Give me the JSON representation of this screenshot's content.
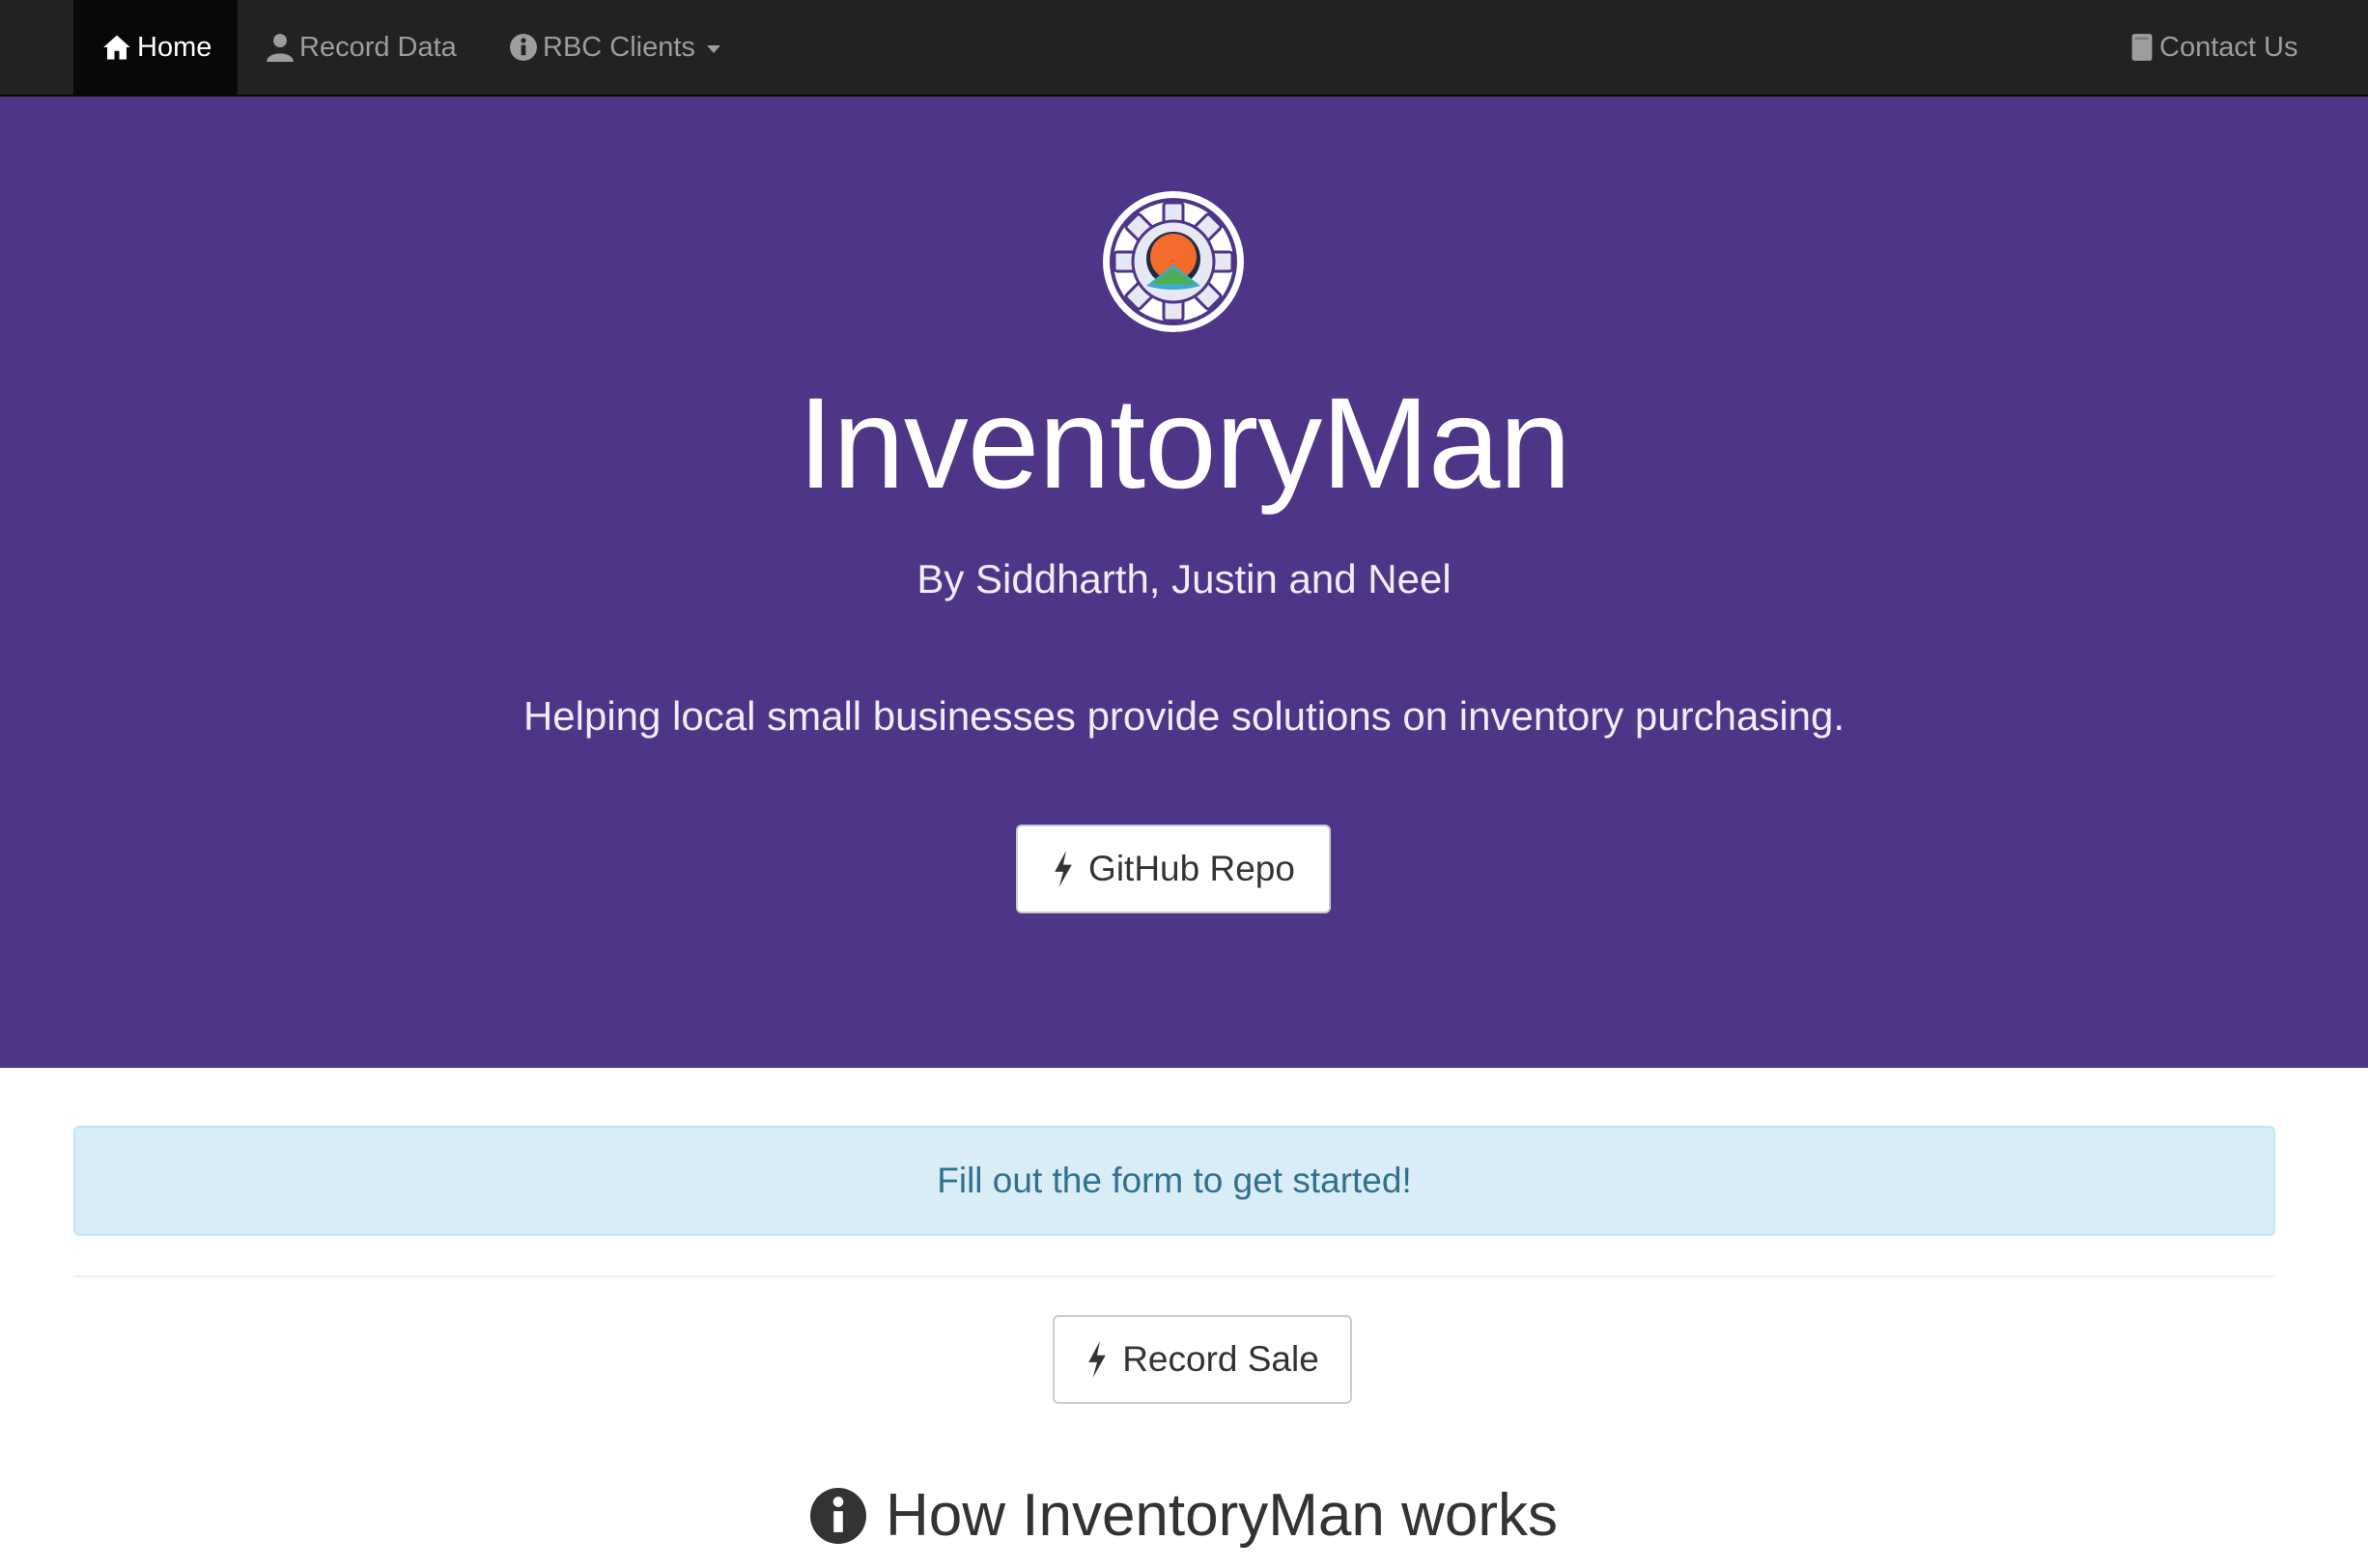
{
  "nav": {
    "home_label": "Home",
    "home_icon": "home-icon",
    "record_label": "Record Data",
    "record_icon": "user-icon",
    "clients_label": "RBC Clients",
    "clients_icon": "info-icon",
    "contact_label": "Contact Us",
    "contact_icon": "book-icon"
  },
  "hero": {
    "logo_icon": "gear-logo-icon",
    "title": "InventoryMan",
    "subtitle": "By Siddharth, Justin and Neel",
    "tagline": "Helping local small businesses provide solutions on inventory purchasing.",
    "github_button": "GitHub Repo",
    "github_icon": "flash-icon",
    "background_color": "#4e3587"
  },
  "main": {
    "alert_text": "Fill out the form to get started!",
    "record_sale_button": "Record Sale",
    "record_sale_icon": "flash-icon",
    "section_heading": "How InventoryMan works",
    "section_icon": "info-circle-icon"
  },
  "colors": {
    "navbar": "#222222",
    "hero": "#4e3587",
    "alert_bg": "#d9edf7",
    "alert_text": "#31708f"
  }
}
